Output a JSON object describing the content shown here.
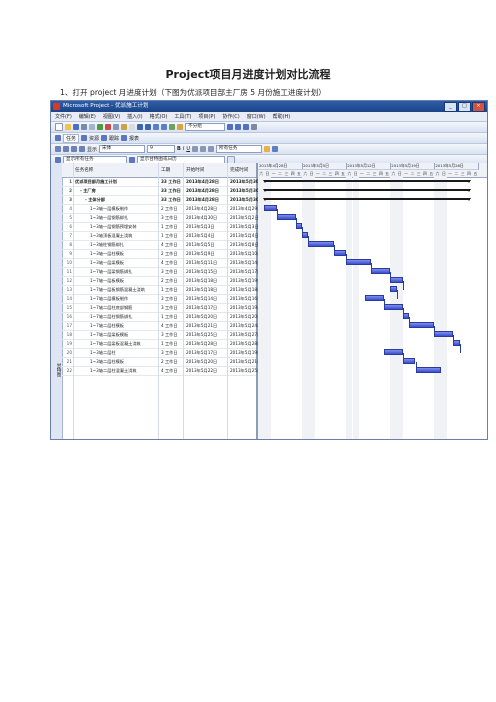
{
  "doc": {
    "title": "Project项目月进度计划对比流程",
    "subtitle": "1、打开 project 月进度计划（下图为优派项目部主厂房 5 月份施工进度计划）"
  },
  "window": {
    "title": "Microsoft Project - 优派施工计划",
    "menu": [
      "文件(F)",
      "编辑(E)",
      "视图(V)",
      "插入(I)",
      "格式(O)",
      "工具(T)",
      "项目(P)",
      "协作(C)",
      "窗口(W)",
      "帮助(H)"
    ],
    "group_combo": "不分组",
    "font_combo": "宋体",
    "size_combo": "9",
    "filter_combo": "所有任务",
    "toolbar_labels": [
      "任务",
      "资源",
      "跟踪",
      "报表"
    ],
    "display_label": "显示",
    "show_tasks_btn": "显示所有任务",
    "layout_combo": "显示甘特图或日历",
    "side_label": "甘特图"
  },
  "sheet": {
    "headers": {
      "name": "任务名称",
      "duration": "工期",
      "start": "开始时间",
      "finish": "完成时间"
    },
    "rows": [
      {
        "id": "1",
        "name": "优派项目部月施工计划",
        "duration": "33 工作日",
        "start": "2013年4月28日",
        "finish": "2013年5月30日",
        "summary": true,
        "indent": 0
      },
      {
        "id": "2",
        "name": "- 主厂房",
        "duration": "33 工作日",
        "start": "2013年4月28日",
        "finish": "2013年5月30日",
        "summary": true,
        "indent": 1
      },
      {
        "id": "3",
        "name": "- 主体分部",
        "duration": "33 工作日",
        "start": "2013年4月28日",
        "finish": "2013年5月30日",
        "summary": true,
        "indent": 2
      },
      {
        "id": "4",
        "name": "1~3轴一层模板制作",
        "duration": "2 工作日",
        "start": "2013年4月28日",
        "finish": "2013年4月29日",
        "indent": 3
      },
      {
        "id": "5",
        "name": "1~3轴一层钢筋绑扎",
        "duration": "3 工作日",
        "start": "2013年4月30日",
        "finish": "2013年5月2日",
        "indent": 3
      },
      {
        "id": "6",
        "name": "1~3轴一层钢筋预埋安装",
        "duration": "1 工作日",
        "start": "2013年5月3日",
        "finish": "2013年5月3日",
        "indent": 3
      },
      {
        "id": "7",
        "name": "1~3轴顶板混凝土浇筑",
        "duration": "1 工作日",
        "start": "2013年5月4日",
        "finish": "2013年5月4日",
        "indent": 3
      },
      {
        "id": "8",
        "name": "1~3轴柱钢筋绑扎",
        "duration": "4 工作日",
        "start": "2013年5月5日",
        "finish": "2013年5月8日",
        "indent": 3
      },
      {
        "id": "9",
        "name": "1~3轴一层柱模板",
        "duration": "2 工作日",
        "start": "2013年5月9日",
        "finish": "2013年5月10日",
        "indent": 3
      },
      {
        "id": "10",
        "name": "1~3轴一层梁模板",
        "duration": "4 工作日",
        "start": "2013年5月11日",
        "finish": "2013年5月14日",
        "indent": 3
      },
      {
        "id": "11",
        "name": "1~7轴一层梁钢筋绑扎",
        "duration": "3 工作日",
        "start": "2013年5月15日",
        "finish": "2013年5月17日",
        "indent": 3
      },
      {
        "id": "12",
        "name": "1~7轴一层板模板",
        "duration": "2 工作日",
        "start": "2013年5月18日",
        "finish": "2013年5月19日",
        "indent": 3
      },
      {
        "id": "13",
        "name": "1~7轴一层板钢筋混凝土浇筑",
        "duration": "1 工作日",
        "start": "2013年5月18日",
        "finish": "2013年5月18日",
        "indent": 3
      },
      {
        "id": "14",
        "name": "1~7轴二层模板制作",
        "duration": "3 工作日",
        "start": "2013年5月14日",
        "finish": "2013年5月16日",
        "indent": 3
      },
      {
        "id": "15",
        "name": "1~7轴二层柱底部钢筋",
        "duration": "3 工作日",
        "start": "2013年5月17日",
        "finish": "2013年5月19日",
        "indent": 3
      },
      {
        "id": "16",
        "name": "1~7轴二层柱钢筋绑扎",
        "duration": "1 工作日",
        "start": "2013年5月20日",
        "finish": "2013年5月20日",
        "indent": 3
      },
      {
        "id": "17",
        "name": "1~7轴二层柱模板",
        "duration": "4 工作日",
        "start": "2013年5月21日",
        "finish": "2013年5月24日",
        "indent": 3
      },
      {
        "id": "18",
        "name": "1~7轴二层梁板模板",
        "duration": "3 工作日",
        "start": "2013年5月25日",
        "finish": "2013年5月27日",
        "indent": 3
      },
      {
        "id": "19",
        "name": "1~7轴二层梁板混凝土浇筑",
        "duration": "1 工作日",
        "start": "2013年5月28日",
        "finish": "2013年5月28日",
        "indent": 3
      },
      {
        "id": "20",
        "name": "1~3轴二层柱",
        "duration": "3 工作日",
        "start": "2013年5月17日",
        "finish": "2013年5月19日",
        "indent": 3
      },
      {
        "id": "21",
        "name": "1~3轴二层柱模板",
        "duration": "2 工作日",
        "start": "2013年5月20日",
        "finish": "2013年5月21日",
        "indent": 3
      },
      {
        "id": "22",
        "name": "1~3轴二层柱混凝土浇筑",
        "duration": "4 工作日",
        "start": "2013年5月22日",
        "finish": "2013年5月25日",
        "indent": 3
      }
    ]
  },
  "gantt": {
    "weeks": [
      "2013年4月28日",
      "2013年5月5日",
      "2013年5月12日",
      "2013年5月19日",
      "2013年5月26日"
    ],
    "day_labels": [
      "六",
      "日",
      "一",
      "二",
      "三",
      "四",
      "五"
    ]
  }
}
